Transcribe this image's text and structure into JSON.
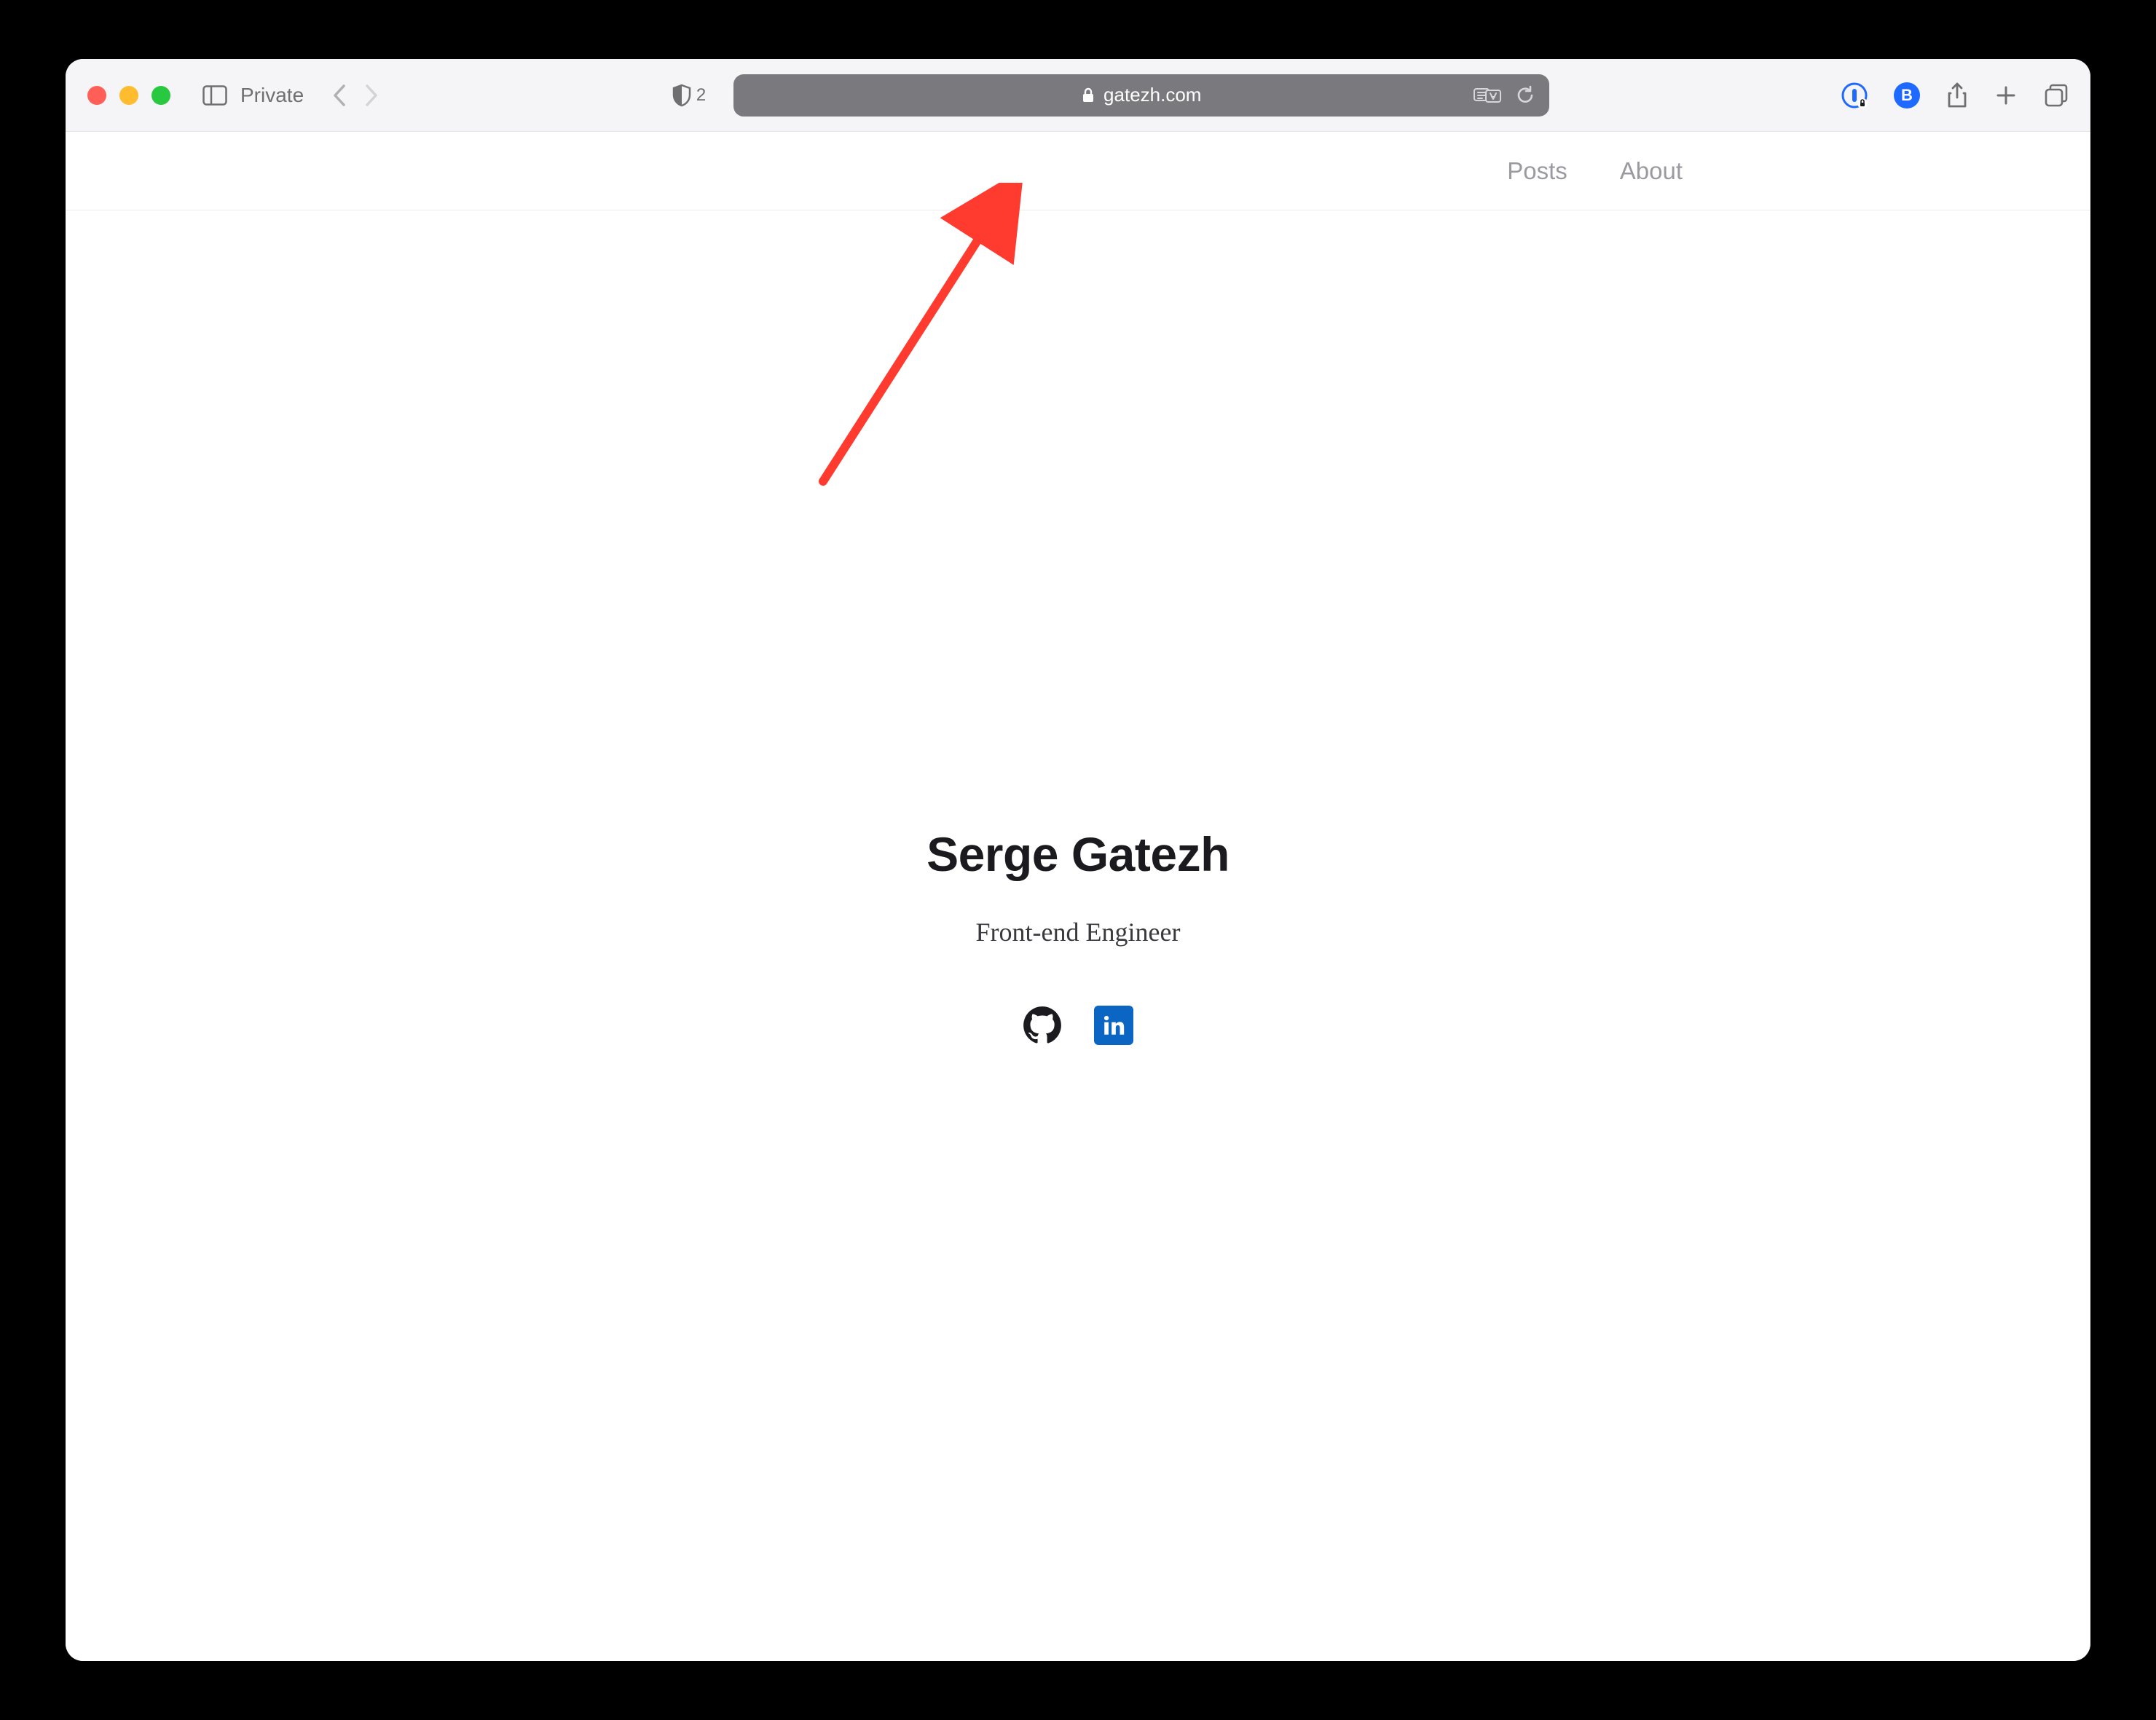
{
  "toolbar": {
    "private_label": "Private",
    "shield_count": "2",
    "address": "gatezh.com",
    "ext_b_label": "B"
  },
  "nav": {
    "links": [
      "Posts",
      "About"
    ]
  },
  "hero": {
    "title": "Serge Gatezh",
    "subtitle": "Front-end Engineer"
  },
  "annotation": {
    "arrow_color": "#ff3b30"
  }
}
